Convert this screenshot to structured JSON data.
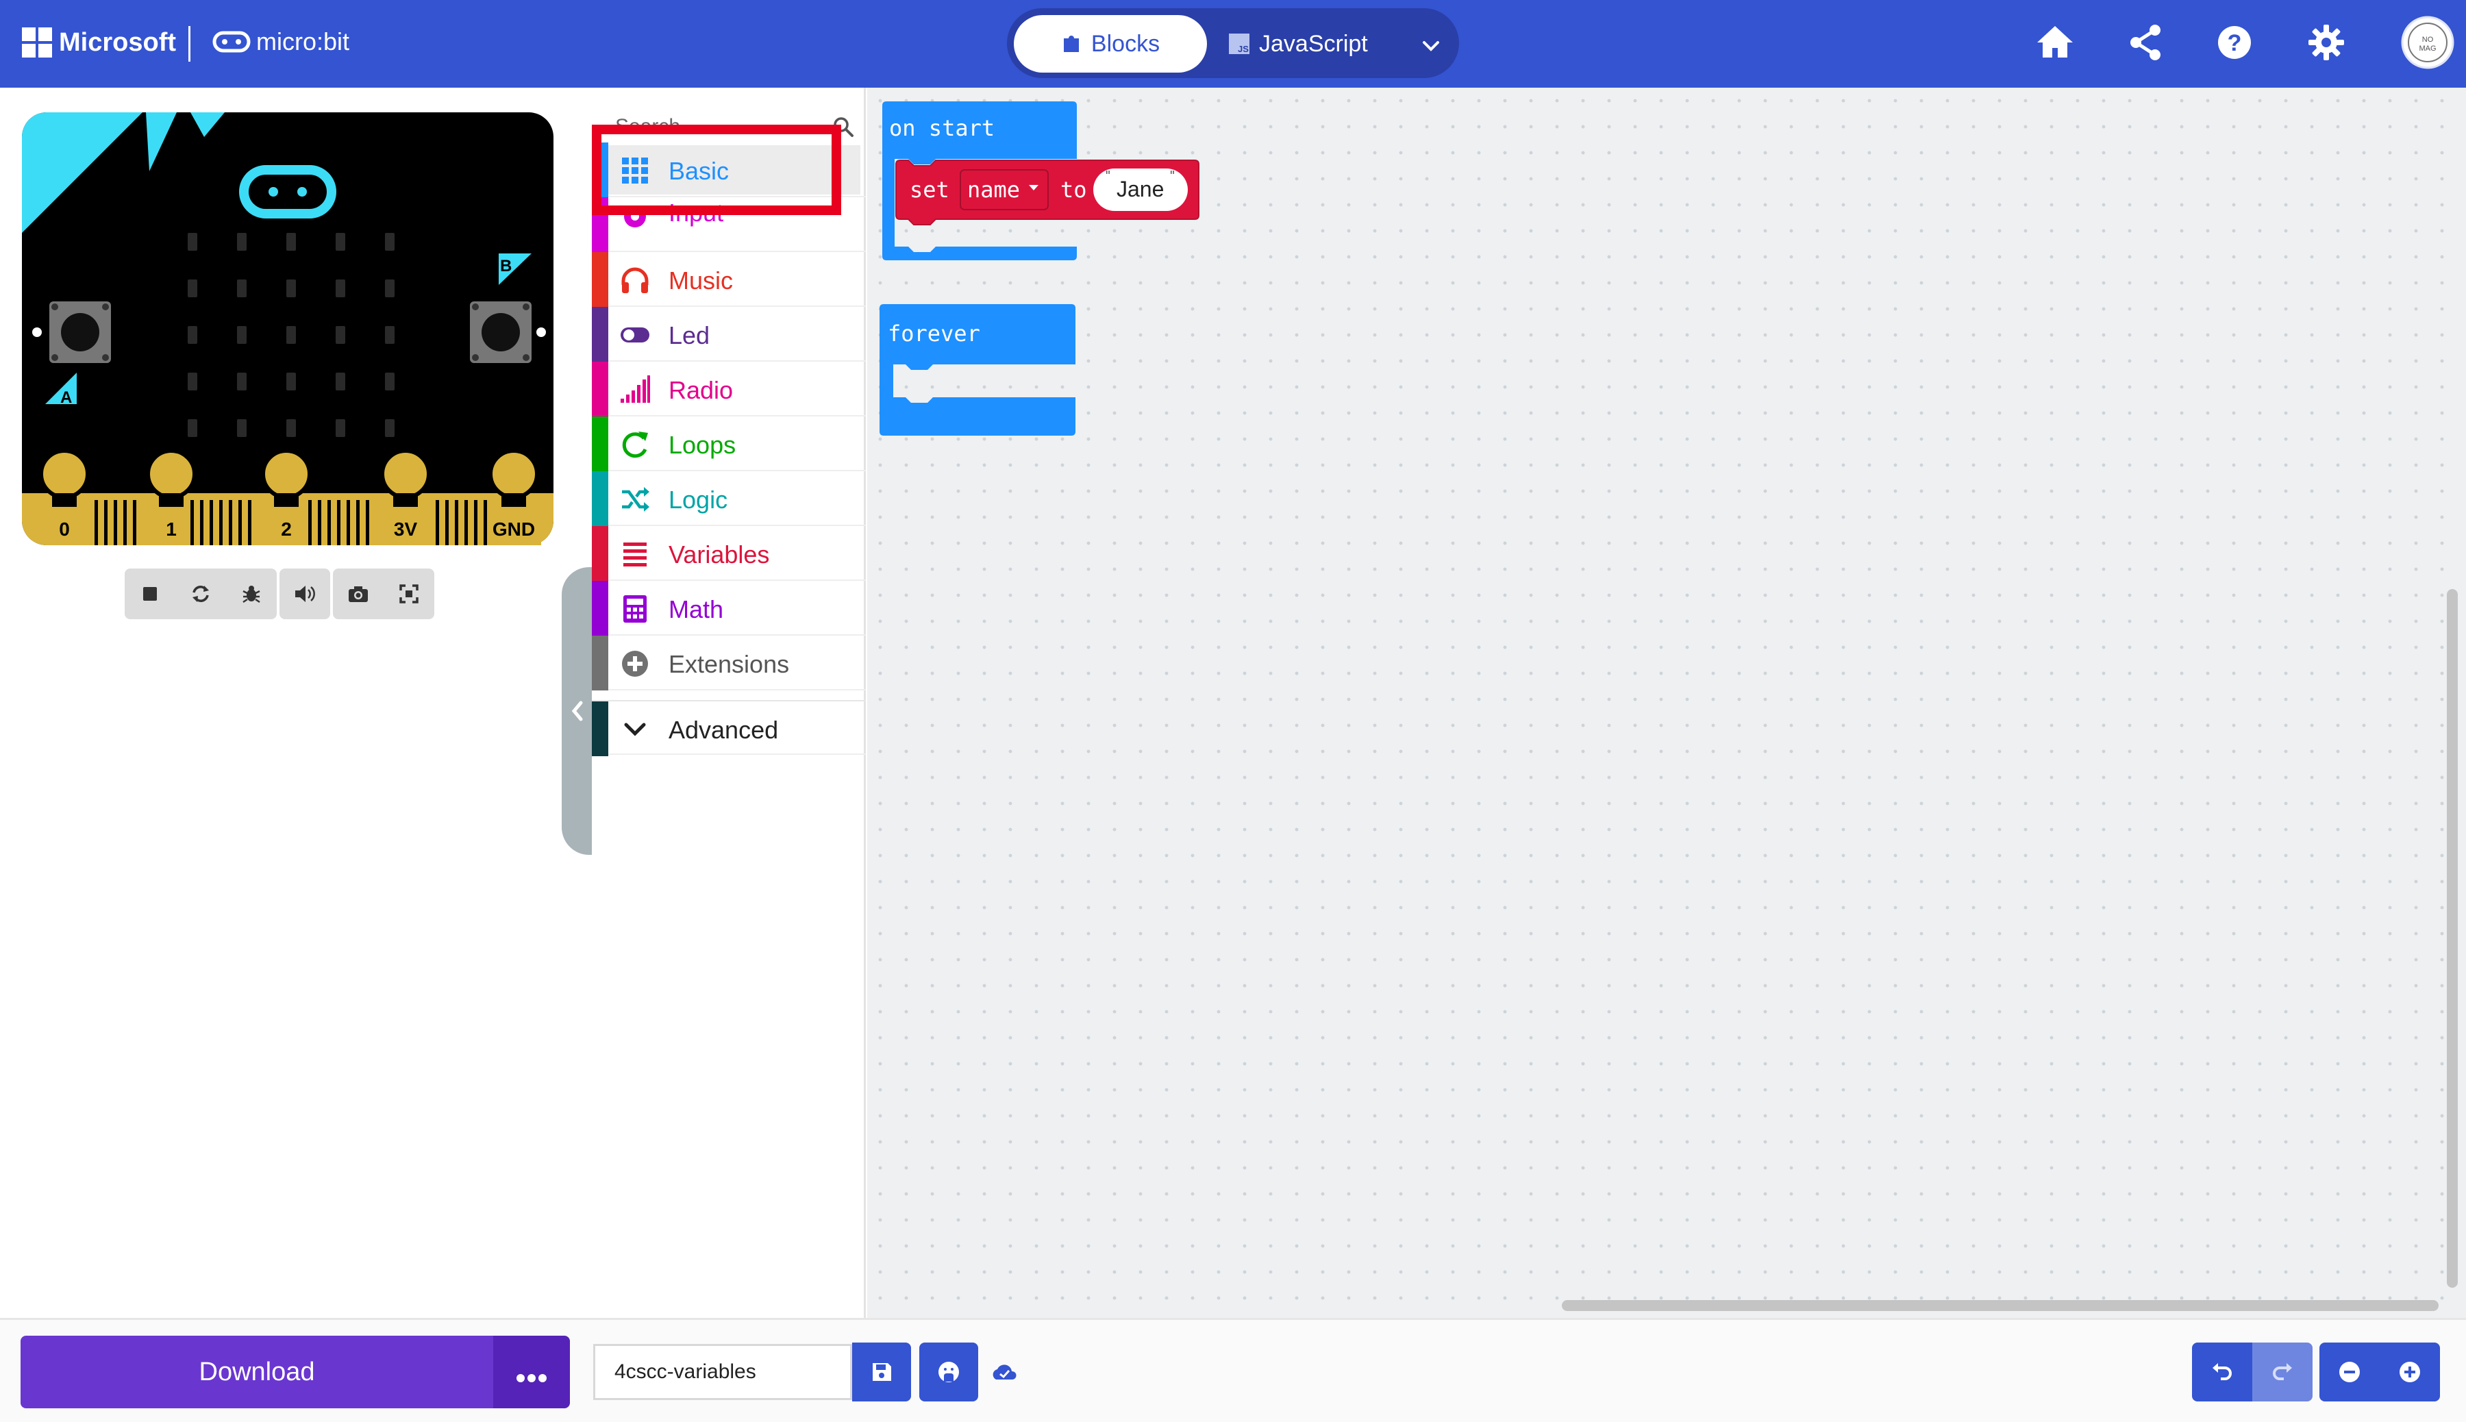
{
  "header": {
    "brand": "Microsoft",
    "product": "micro:bit",
    "modes": [
      {
        "label": "Blocks",
        "active": true
      },
      {
        "label": "JavaScript",
        "active": false
      }
    ],
    "icons": [
      "home-icon",
      "share-icon",
      "help-icon",
      "settings-icon",
      "avatar"
    ],
    "avatar_text": "NO\nMAG"
  },
  "simulator": {
    "pin_labels": [
      "0",
      "1",
      "2",
      "3V",
      "GND"
    ],
    "button_labels": [
      "A",
      "B"
    ],
    "toolbar": [
      "stop-icon",
      "restart-icon",
      "debug-icon",
      "sound-icon",
      "screenshot-icon",
      "fullscreen-icon"
    ]
  },
  "toolbox": {
    "search_placeholder": "Search...",
    "categories": [
      {
        "label": "Basic",
        "color": "#1e90ff",
        "icon": "grid-icon"
      },
      {
        "label": "Input",
        "color": "#d400d4",
        "icon": "input-circle-icon"
      },
      {
        "label": "Music",
        "color": "#e63022",
        "icon": "headphones-icon"
      },
      {
        "label": "Led",
        "color": "#5c2d91",
        "icon": "toggle-icon"
      },
      {
        "label": "Radio",
        "color": "#e3008c",
        "icon": "signal-bars-icon"
      },
      {
        "label": "Loops",
        "color": "#00aa00",
        "icon": "refresh-icon"
      },
      {
        "label": "Logic",
        "color": "#00a4a6",
        "icon": "shuffle-icon"
      },
      {
        "label": "Variables",
        "color": "#dc143c",
        "icon": "lines-icon"
      },
      {
        "label": "Math",
        "color": "#9400d3",
        "icon": "calculator-icon"
      },
      {
        "label": "Extensions",
        "color": "#717171",
        "icon": "plus-circle-icon"
      },
      {
        "label": "Advanced",
        "color": "#0d3a41",
        "icon": "chevron-down-icon"
      }
    ]
  },
  "workspace": {
    "on_start": {
      "label": "on start",
      "set_block": {
        "set": "set",
        "variable": "name",
        "to": "to",
        "value": "Jane"
      }
    },
    "forever": {
      "label": "forever"
    }
  },
  "bottom": {
    "download_label": "Download",
    "project_name": "4cscc-variables",
    "icons": [
      "save-icon",
      "github-icon",
      "cloud-icon",
      "undo-icon",
      "redo-icon",
      "zoom-out-icon",
      "zoom-in-icon"
    ]
  },
  "colors": {
    "header": "#3454d1",
    "basic": "#1e90ff",
    "variables": "#dc143c",
    "download": "#6a36d0",
    "highlight": "#e8001f"
  }
}
